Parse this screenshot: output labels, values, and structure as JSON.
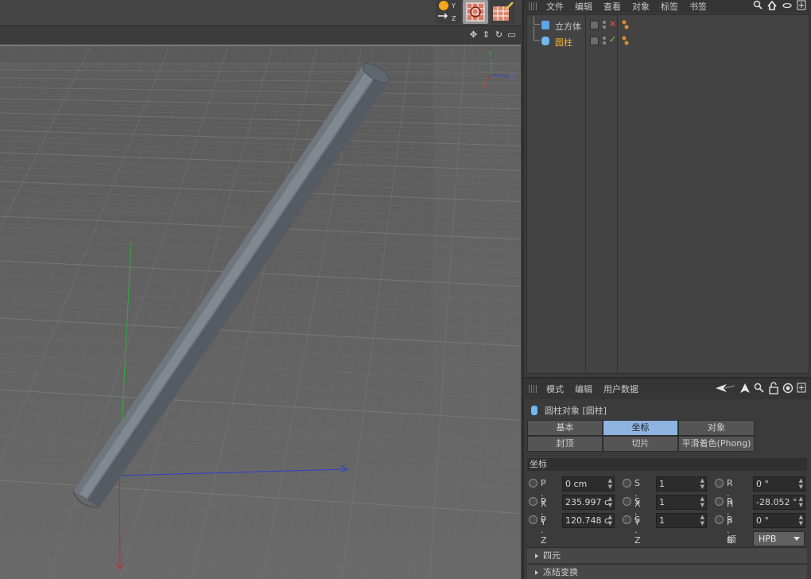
{
  "object_manager": {
    "menu": [
      "文件",
      "编辑",
      "查看",
      "对象",
      "标签",
      "书签"
    ],
    "objects": [
      {
        "name": "立方体",
        "icon": "cube-icon",
        "color": "#c8c8c8",
        "status": "×",
        "status_color": "#e04a3a"
      },
      {
        "name": "圆柱",
        "icon": "cylinder-icon",
        "color": "#f0b232",
        "status": "✓",
        "status_color": "#7bd34a"
      }
    ]
  },
  "attribute_manager": {
    "menu": [
      "模式",
      "编辑",
      "用户数据"
    ],
    "title": "圆柱对象 [圆柱]",
    "tabs": [
      {
        "label": "基本",
        "active": false
      },
      {
        "label": "坐标",
        "active": true
      },
      {
        "label": "对象",
        "active": false
      },
      {
        "label": "封顶",
        "active": false
      },
      {
        "label": "切片",
        "active": false
      },
      {
        "label": "平滑着色(Phong)",
        "active": false
      }
    ],
    "section": "坐标",
    "rows": [
      [
        {
          "label": "P . X",
          "value": "0 cm"
        },
        {
          "label": "S . X",
          "value": "1"
        },
        {
          "label": "R . H",
          "value": "0 °"
        }
      ],
      [
        {
          "label": "P . Y",
          "value": "235.997 c"
        },
        {
          "label": "S . Y",
          "value": "1"
        },
        {
          "label": "R . P",
          "value": "-28.052 °"
        }
      ],
      [
        {
          "label": "P . Z",
          "value": "120.748 c"
        },
        {
          "label": "S . Z",
          "value": "1"
        },
        {
          "label": "R . B",
          "value": "0 °"
        }
      ]
    ],
    "order_label": "顺序",
    "order_value": "HPB",
    "collapsed_sections": [
      "四元",
      "冻结变换"
    ]
  },
  "viewport": {
    "axis_gizmo": {
      "y": "Y",
      "z": "Z",
      "x": "X"
    }
  },
  "colors": {
    "active_tab": "#8eb3e0",
    "axis_x": "#c22a2a",
    "axis_y": "#2fae3a",
    "axis_z": "#2f3fd0"
  }
}
